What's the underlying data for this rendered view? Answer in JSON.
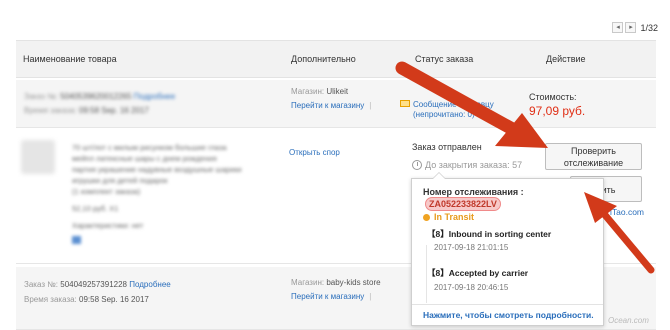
{
  "pager": {
    "prev_icon": "chevron-left-icon",
    "next_icon": "chevron-right-icon",
    "prev_glyph": "◂",
    "next_glyph": "▸",
    "text": "1/32"
  },
  "columns": {
    "product": "Наименование товара",
    "extra": "Дополнительно",
    "status": "Статус заказа",
    "action": "Действие"
  },
  "order1": {
    "order_label": "Заказ №:",
    "order_number": "5040539620012265",
    "details_link": "Подробнее",
    "time_label": "Время заказа:",
    "time_value": "09:58 Sep. 16 2017",
    "shop_label": "Магазин:",
    "shop_name": "Ulikeit",
    "shop_link": "Перейти к магазину",
    "message_link_line1": "Сообщение продавцу",
    "message_link_line2": "(непрочитано: 0)",
    "price_label": "Стоимость:",
    "price_value": "97,09 руб."
  },
  "item1": {
    "description": "70 шт/лот с милым рисунком большие глаза мейпл латексные шары с днем рождения партия украшение надувные воздушные шарики игрушки для детей подарок",
    "sub_note": "(1 комплект заказа)",
    "price_line": "52,10 руб. X1",
    "attr_line": "Характеристики: нет",
    "open_dispute": "Открыть спор",
    "status": "Заказ отправлен",
    "close_label": "До закрытия заказа: 57",
    "track_button_line1": "Проверить",
    "track_button_line2": "отслеживание",
    "second_button": "рить",
    "right_link": "iTao.com"
  },
  "tracking": {
    "number_label": "Номер отслеживания :",
    "number": "ZA052233822LV",
    "state": "In Transit",
    "events": [
      {
        "code": "【8】",
        "text": "Inbound in sorting center",
        "time": "2017-09-18 21:01:15"
      },
      {
        "code": "【8】",
        "text": "Accepted by carrier",
        "time": "2017-09-18 20:46:15"
      }
    ],
    "more_link": "Нажмите, чтобы смотреть подробности."
  },
  "order2": {
    "order_label": "Заказ №:",
    "order_number": "504049257391228",
    "details_link": "Подробнее",
    "time_label": "Время заказа:",
    "time_value": "09:58 Sep. 16 2017",
    "shop_label": "Магазин:",
    "shop_name": "baby-kids store",
    "shop_link": "Перейти к магазину"
  },
  "watermark": "Ocean.com",
  "colors": {
    "link": "#2a6ebb",
    "price": "#e02f16",
    "arrow": "#d23a1a",
    "transit": "#e79b1c",
    "tracking_highlight": "#f7c9c9"
  }
}
